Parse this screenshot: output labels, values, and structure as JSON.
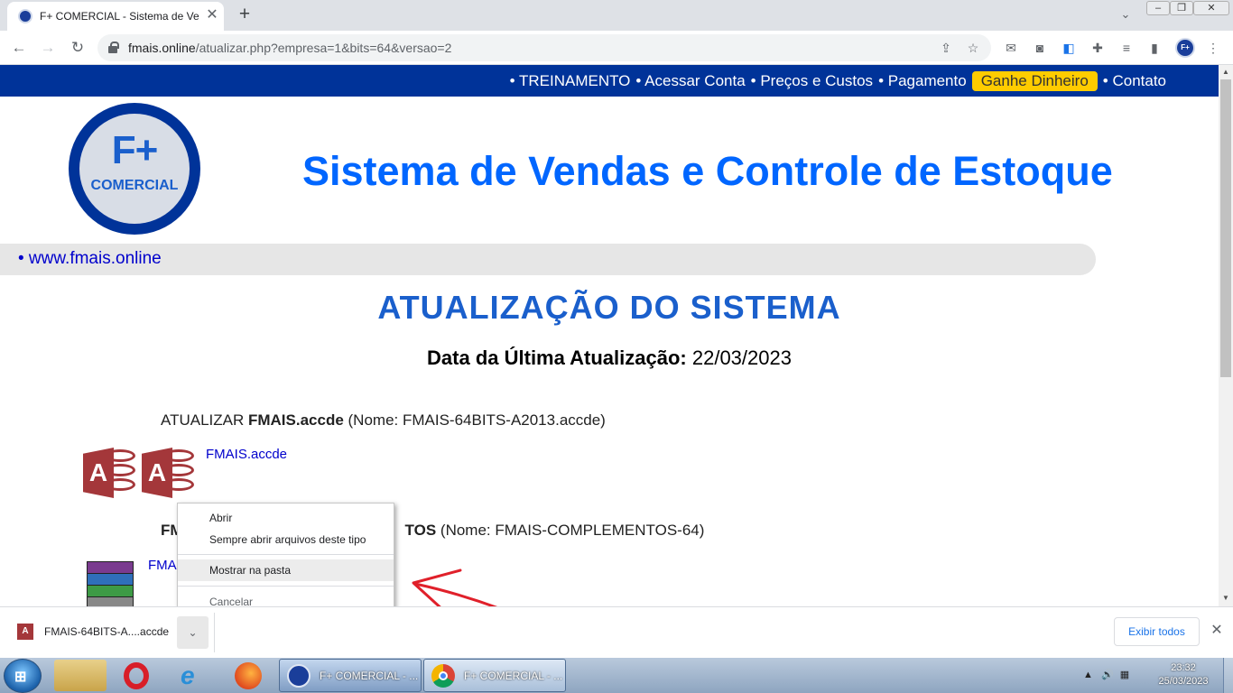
{
  "browser": {
    "tab_title": "F+ COMERCIAL - Sistema de Vendas",
    "tab_close": "✕",
    "new_tab": "+",
    "url_host": "fmais.online",
    "url_path": "/atualizar.php?empresa=1&bits=64&versao=2",
    "toolbar_icons": [
      "back-icon",
      "forward-icon",
      "reload-icon",
      "share-icon",
      "bookmark-star-icon",
      "gmail-icon",
      "camera-icon",
      "translate-icon",
      "extensions-icon",
      "reading-list-icon",
      "side-panel-icon",
      "profile-icon"
    ],
    "profile_label": "F+"
  },
  "site": {
    "nav": {
      "treinamento": "• TREINAMENTO",
      "acessar": "• Acessar Conta",
      "precos": "• Preços e Custos",
      "pagamento": "• Pagamento",
      "ganhe": "Ganhe Dinheiro",
      "contato": "• Contato"
    },
    "logo_text": "F+",
    "logo_sub": "COMERCIAL",
    "title": "Sistema de Vendas e Controle de Estoque",
    "website_link": "• www.fmais.online",
    "heading": "ATUALIZAÇÃO DO SISTEMA",
    "last_update_label": "Data da Última Atualização:",
    "last_update_value": "22/03/2023",
    "item1_prefix": "ATUALIZAR ",
    "item1_bold": "FMAIS.accde",
    "item1_suffix": " (Nome: FMAIS-64BITS-A2013.accde)",
    "item1_link": "FMAIS.accde",
    "item2_prefix": "FM",
    "item2_bold": "TOS",
    "item2_suffix": " (Nome: FMAIS-COMPLEMENTOS-64)",
    "item2_link": "FMA"
  },
  "context_menu": {
    "items": [
      "Abrir",
      "Sempre abrir arquivos deste tipo",
      "Mostrar na pasta",
      "Cancelar"
    ],
    "highlighted": "Mostrar na pasta"
  },
  "download_bar": {
    "file_name": "FMAIS-64BITS-A....accde",
    "show_all": "Exibir todos"
  },
  "taskbar": {
    "tasks": [
      "F+ COMERCIAL - ...",
      "F+ COMERCIAL - ..."
    ],
    "time": "23:32",
    "date": "25/03/2023"
  },
  "colors": {
    "nav_blue": "#003399",
    "title_blue": "#0066ff",
    "heading_blue": "#1a5fcc",
    "highlight_yellow": "#ffcc00",
    "annotation_red": "#e0202a"
  }
}
